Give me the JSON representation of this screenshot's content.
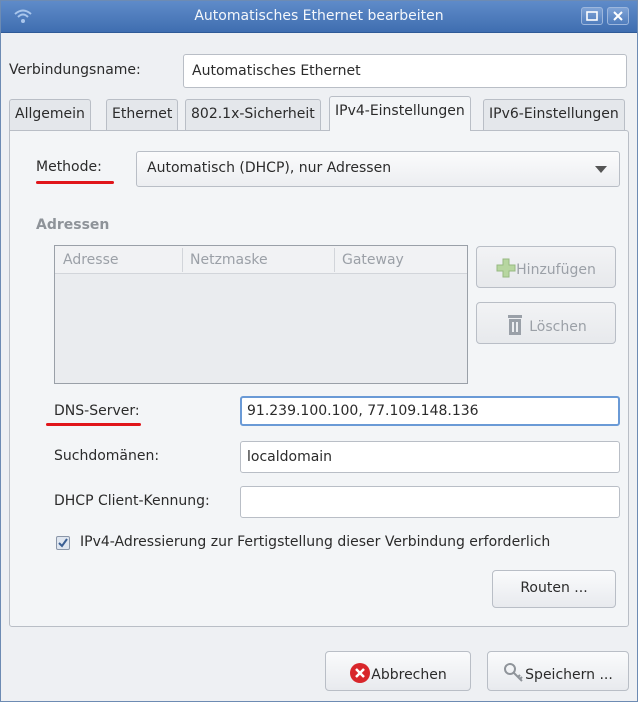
{
  "window": {
    "title": "Automatisches Ethernet bearbeiten"
  },
  "connection": {
    "name_label": "Verbindungsname:",
    "name_value": "Automatisches Ethernet"
  },
  "tabs": [
    {
      "label": "Allgemein"
    },
    {
      "label": "Ethernet"
    },
    {
      "label": "802.1x-Sicherheit"
    },
    {
      "label": "IPv4-Einstellungen",
      "active": true
    },
    {
      "label": "IPv6-Einstellungen"
    }
  ],
  "ipv4": {
    "method_label": "Methode:",
    "method_value": "Automatisch (DHCP), nur Adressen",
    "addresses_title": "Adressen",
    "columns": [
      "Adresse",
      "Netzmaske",
      "Gateway"
    ],
    "add_button": "Hinzufügen",
    "delete_button": "Löschen",
    "dns_label": "DNS-Server:",
    "dns_value": "91.239.100.100, 77.109.148.136",
    "search_label": "Suchdomänen:",
    "search_value": "localdomain",
    "dhcp_label": "DHCP Client-Kennung:",
    "dhcp_value": "",
    "require_label": "IPv4-Adressierung zur Fertigstellung dieser Verbindung erforderlich",
    "require_checked": true,
    "routes_button": "Routen ..."
  },
  "footer": {
    "cancel_button": "Abbrechen",
    "save_button": "Speichern ..."
  },
  "colors": {
    "accent": "#e0151a",
    "titlebar": "#4f7dbd",
    "focus": "#6a9ad6",
    "cancel_red": "#d8262b"
  },
  "icons": [
    "wifi-icon",
    "maximize-icon",
    "close-icon",
    "dropdown-arrow-icon",
    "plus-icon",
    "trash-icon",
    "checkbox-check-icon",
    "cancel-icon",
    "keys-icon"
  ]
}
